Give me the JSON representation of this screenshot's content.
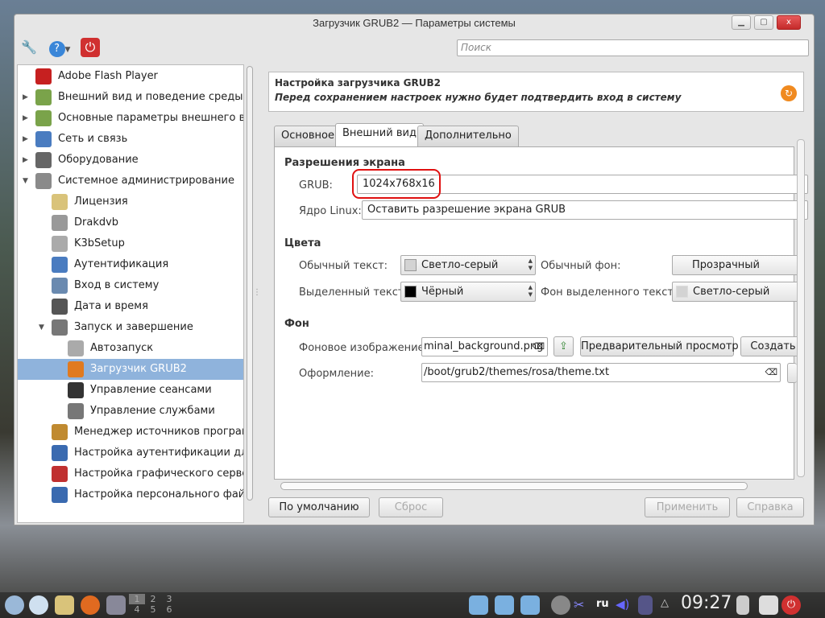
{
  "window": {
    "title": "Загрузчик GRUB2 — Параметры системы",
    "minimize": "▁",
    "maximize": "▢",
    "close": "x"
  },
  "toolbar": {
    "search_placeholder": "Поиск"
  },
  "sidebar": {
    "items": [
      {
        "label": "Adobe Flash Player",
        "level": 0,
        "expander": "",
        "color": "#c62020"
      },
      {
        "label": "Внешний вид и поведение среды раб",
        "level": 0,
        "expander": "▶",
        "color": "#7aa34a"
      },
      {
        "label": "Основные параметры внешнего вида",
        "level": 0,
        "expander": "▶",
        "color": "#7aa34a"
      },
      {
        "label": "Сеть и связь",
        "level": 0,
        "expander": "▶",
        "color": "#4a7cc0"
      },
      {
        "label": "Оборудование",
        "level": 0,
        "expander": "▶",
        "color": "#666"
      },
      {
        "label": "Системное администрирование",
        "level": 0,
        "expander": "▼",
        "color": "#8a8a8a"
      },
      {
        "label": "Лицензия",
        "level": 1,
        "expander": "",
        "color": "#d9c37a"
      },
      {
        "label": "Drakdvb",
        "level": 1,
        "expander": "",
        "color": "#999"
      },
      {
        "label": "K3bSetup",
        "level": 1,
        "expander": "",
        "color": "#aaa"
      },
      {
        "label": "Аутентификация",
        "level": 1,
        "expander": "",
        "color": "#4a7cc0"
      },
      {
        "label": "Вход в систему",
        "level": 1,
        "expander": "",
        "color": "#6a8ab0"
      },
      {
        "label": "Дата и время",
        "level": 1,
        "expander": "",
        "color": "#555"
      },
      {
        "label": "Запуск и завершение",
        "level": 1,
        "expander": "▼",
        "color": "#777"
      },
      {
        "label": "Автозапуск",
        "level": 2,
        "expander": "",
        "color": "#aaa"
      },
      {
        "label": "Загрузчик GRUB2",
        "level": 2,
        "expander": "",
        "color": "#e07a20",
        "selected": true
      },
      {
        "label": "Управление сеансами",
        "level": 2,
        "expander": "",
        "color": "#333"
      },
      {
        "label": "Управление службами",
        "level": 2,
        "expander": "",
        "color": "#777"
      },
      {
        "label": "Менеджер источников программ",
        "level": 1,
        "expander": "",
        "color": "#c08a30"
      },
      {
        "label": "Настройка аутентификации для ут",
        "level": 1,
        "expander": "",
        "color": "#3a6ab0"
      },
      {
        "label": "Настройка графического сервера",
        "level": 1,
        "expander": "",
        "color": "#c03030"
      },
      {
        "label": "Настройка персонального файерв",
        "level": 1,
        "expander": "",
        "color": "#3a6ab0"
      }
    ]
  },
  "header": {
    "title": "Настройка загрузчика GRUB2",
    "subtitle": "Перед сохранением настроек нужно будет подтвердить вход в систему"
  },
  "tabs": [
    {
      "label": "Основное"
    },
    {
      "label": "Внешний вид",
      "active": true
    },
    {
      "label": "Дополнительно"
    }
  ],
  "resolution": {
    "heading": "Разрешения экрана",
    "grub_label": "GRUB:",
    "grub_value": "1024x768x16",
    "linux_label": "Ядро Linux:",
    "linux_value": "Оставить разрешение экрана GRUB"
  },
  "colors": {
    "heading": "Цвета",
    "normal_text_label": "Обычный текст:",
    "normal_text_value": "Светло-серый",
    "normal_text_color": "#d3d3d3",
    "normal_bg_label": "Обычный фон:",
    "normal_bg_value": "Прозрачный",
    "hl_text_label": "Выделенный текст:",
    "hl_text_value": "Чёрный",
    "hl_text_color": "#000000",
    "hl_bg_label": "Фон выделенного текста:",
    "hl_bg_value": "Светло-серый",
    "hl_bg_color": "#d3d3d3"
  },
  "background": {
    "heading": "Фон",
    "image_label": "Фоновое изображение:",
    "image_value": "minal_background.png",
    "preview_button": "Предварительный просмотр",
    "create_button": "Создать",
    "theme_label": "Оформление:",
    "theme_value": "/boot/grub2/themes/rosa/theme.txt"
  },
  "buttons": {
    "defaults": "По умолчанию",
    "reset": "Сброс",
    "apply": "Применить",
    "help": "Справка"
  },
  "taskbar": {
    "desktops": [
      "1",
      "2",
      "3",
      "4",
      "5",
      "6"
    ],
    "lang": "ru",
    "clock": "09:27"
  }
}
